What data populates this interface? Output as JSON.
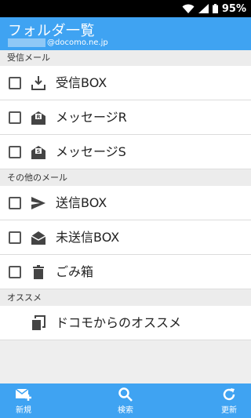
{
  "status_bar": {
    "battery": "95%",
    "icons": [
      "wifi-icon",
      "signal-icon",
      "battery-icon"
    ]
  },
  "header": {
    "title": "フォルダ一覧",
    "account_domain": "@docomo.ne.jp"
  },
  "sections": [
    {
      "title": "受信メール",
      "items": [
        {
          "label": "受信BOX",
          "icon": "inbox-download-icon"
        },
        {
          "label": "メッセージR",
          "icon": "envelope-r-icon"
        },
        {
          "label": "メッセージS",
          "icon": "envelope-s-icon"
        }
      ]
    },
    {
      "title": "その他のメール",
      "items": [
        {
          "label": "送信BOX",
          "icon": "send-icon"
        },
        {
          "label": "未送信BOX",
          "icon": "envelope-open-icon"
        },
        {
          "label": "ごみ箱",
          "icon": "trash-icon"
        }
      ]
    },
    {
      "title": "オススメ",
      "items": [
        {
          "label": "ドコモからのオススメ",
          "icon": "copy-icon"
        }
      ]
    }
  ],
  "bottom_bar": {
    "new_label": "新規",
    "search_label": "検索",
    "refresh_label": "更新"
  },
  "colors": {
    "accent": "#3fa3f2",
    "status_bar": "#000000",
    "section_bg": "#ececec"
  }
}
